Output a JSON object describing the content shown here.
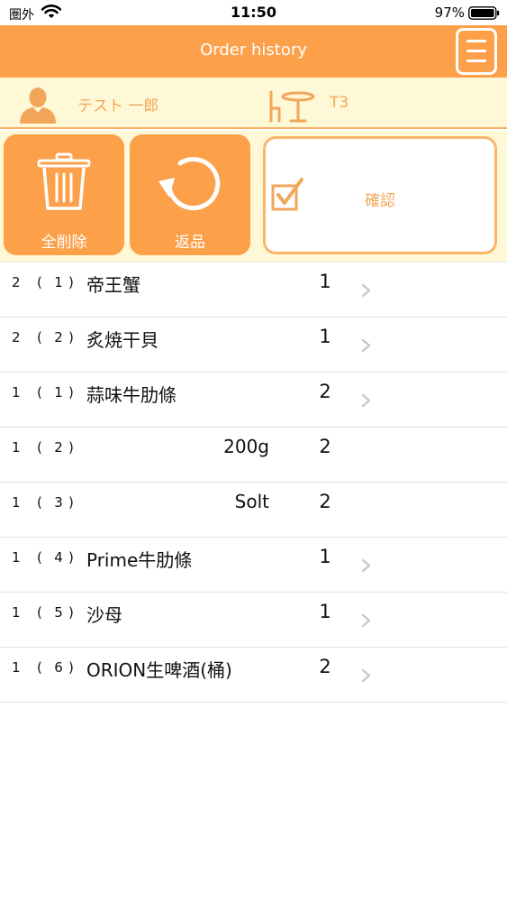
{
  "status_bar": {
    "carrier": "圏外",
    "time": "11:50",
    "battery": "97%"
  },
  "header": {
    "title": "Order history",
    "menu_icon": "hamburger-menu-icon"
  },
  "info": {
    "user_name": "テスト 一郎",
    "table_name": "T3"
  },
  "actions": {
    "delete_all_label": "全削除",
    "return_label": "返品",
    "confirm_label": "確認"
  },
  "orders": [
    {
      "seq": "2",
      "sub": "1",
      "name": "帝王蟹",
      "option": "",
      "qty": "1",
      "has_chevron": true
    },
    {
      "seq": "2",
      "sub": "2",
      "name": "炙焼干貝",
      "option": "",
      "qty": "1",
      "has_chevron": true
    },
    {
      "seq": "1",
      "sub": "1",
      "name": "蒜味牛肋條",
      "option": "",
      "qty": "2",
      "has_chevron": true
    },
    {
      "seq": "1",
      "sub": "2",
      "name": "",
      "option": "200g",
      "qty": "2",
      "has_chevron": false
    },
    {
      "seq": "1",
      "sub": "3",
      "name": "",
      "option": "Solt",
      "qty": "2",
      "has_chevron": false
    },
    {
      "seq": "1",
      "sub": "4",
      "name": "Prime牛肋條",
      "option": "",
      "qty": "1",
      "has_chevron": true
    },
    {
      "seq": "1",
      "sub": "5",
      "name": "沙母",
      "option": "",
      "qty": "1",
      "has_chevron": true
    },
    {
      "seq": "1",
      "sub": "6",
      "name": "ORION生啤酒(桶)",
      "option": "",
      "qty": "2",
      "has_chevron": true
    }
  ],
  "colors": {
    "accent": "#FDA04A",
    "info_bg": "#FFF8D6",
    "accent_text": "#F2A65A"
  }
}
